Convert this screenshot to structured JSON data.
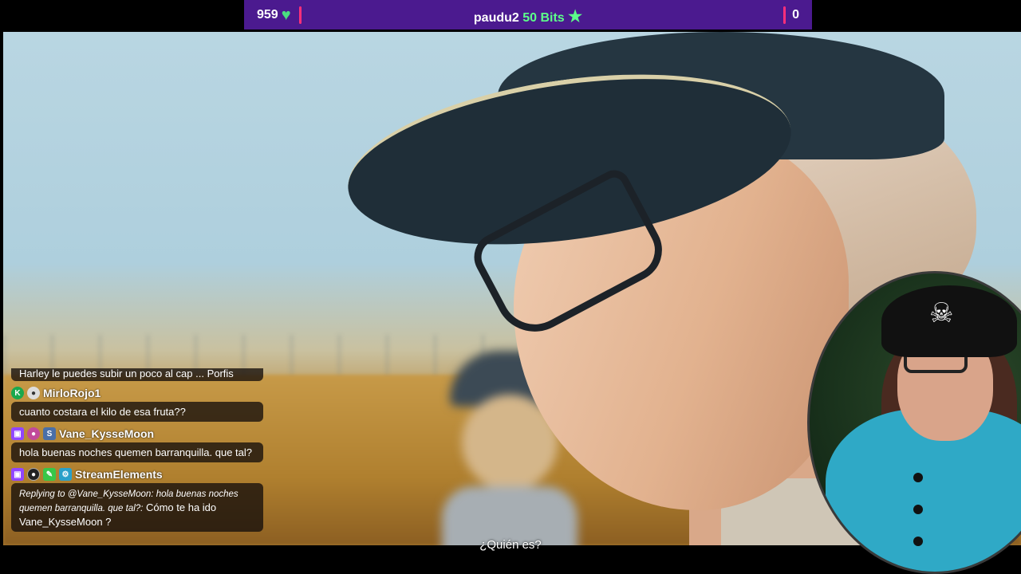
{
  "topbar": {
    "likes_count": "959",
    "event_user": "paudu2",
    "event_amount": "50 Bits",
    "counter_right": "0"
  },
  "video": {
    "subtitle": "¿Quién es?"
  },
  "chat": {
    "partial_message": "Harley le puedes subir un poco al cap ... Porfis",
    "messages": [
      {
        "user": "MirloRojo1",
        "text": "cuanto costara el kilo de esa fruta??"
      },
      {
        "user": "Vane_KysseMoon",
        "text": "hola buenas noches quemen barranquilla. que tal?"
      },
      {
        "user": "StreamElements",
        "reply": "Replying to @Vane_KysseMoon: hola buenas noches quemen barranquilla. que tal?:",
        "text": "Cómo te ha ido Vane_KysseMoon ?"
      }
    ]
  },
  "webcam": {
    "emblem": "☠"
  }
}
